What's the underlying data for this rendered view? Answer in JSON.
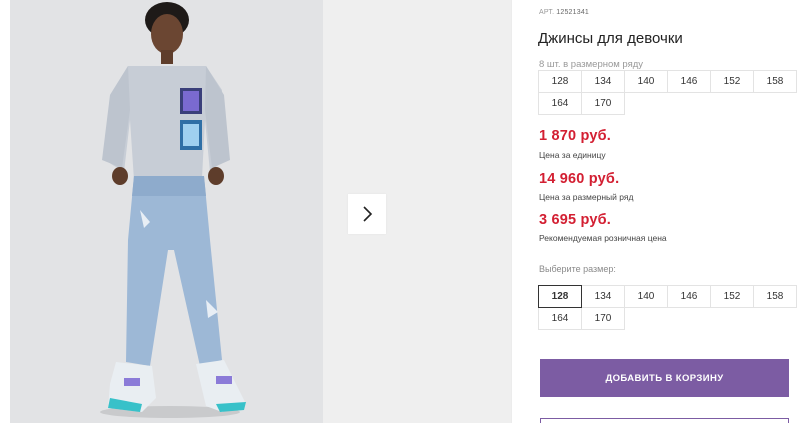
{
  "gallery": {
    "next_icon": "chevron-right-icon"
  },
  "product": {
    "article_label": "АРТ.",
    "article_number": "12521341",
    "title": "Джинсы для девочки",
    "pack_caption": "8 шт. в размерном ряду",
    "pack_sizes": [
      "128",
      "134",
      "140",
      "146",
      "152",
      "158",
      "164",
      "170"
    ]
  },
  "prices": {
    "unit_price": "1 870 руб.",
    "unit_caption": "Цена за единицу",
    "pack_price": "14 960 руб.",
    "pack_caption": "Цена за размерный ряд",
    "retail_price": "3 695 руб.",
    "retail_caption": "Рекомендуемая розничная цена"
  },
  "size_select": {
    "label": "Выберите размер:",
    "sizes": [
      "128",
      "134",
      "140",
      "146",
      "152",
      "158",
      "164",
      "170"
    ],
    "selected": "128"
  },
  "cart": {
    "add_label": "ДОБАВИТЬ В КОРЗИНУ"
  },
  "colors": {
    "accent": "#7c5ca3",
    "price": "#d31f32"
  }
}
